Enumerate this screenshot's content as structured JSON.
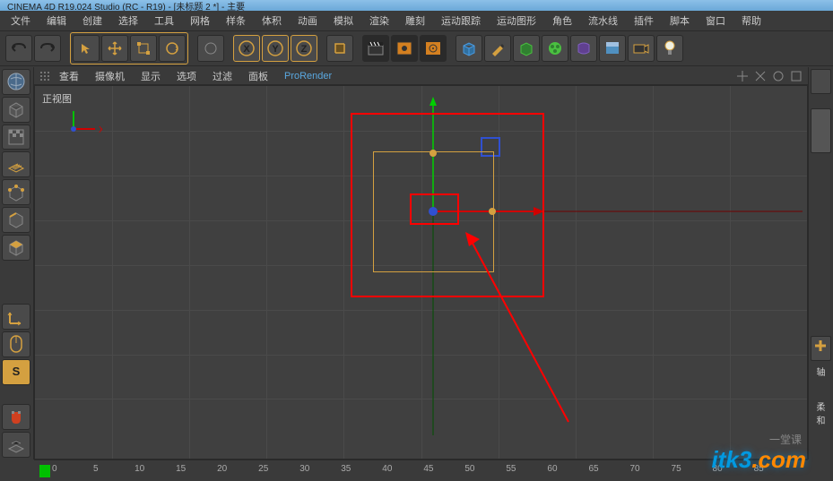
{
  "titlebar": "CINEMA 4D R19.024 Studio (RC - R19) - [未标题 2 *] - 主要",
  "menubar": [
    "文件",
    "编辑",
    "创建",
    "选择",
    "工具",
    "网格",
    "样条",
    "体积",
    "动画",
    "模拟",
    "渲染",
    "雕刻",
    "运动跟踪",
    "运动图形",
    "角色",
    "流水线",
    "插件",
    "脚本",
    "窗口",
    "帮助"
  ],
  "viewport_menus": [
    "查看",
    "摄像机",
    "显示",
    "选项",
    "过滤",
    "面板"
  ],
  "viewport_prorender": "ProRender",
  "viewport_label": "正视图",
  "axis_x": "X",
  "right_labels": [
    "轴",
    "柔和"
  ],
  "timeline_ticks": [
    "0",
    "5",
    "10",
    "15",
    "20",
    "25",
    "30",
    "35",
    "40",
    "45",
    "50",
    "55",
    "60",
    "65",
    "70",
    "75",
    "80",
    "85"
  ],
  "watermark_main": "itk3",
  "watermark_ext": ".com",
  "watermark_sub": "一堂课"
}
